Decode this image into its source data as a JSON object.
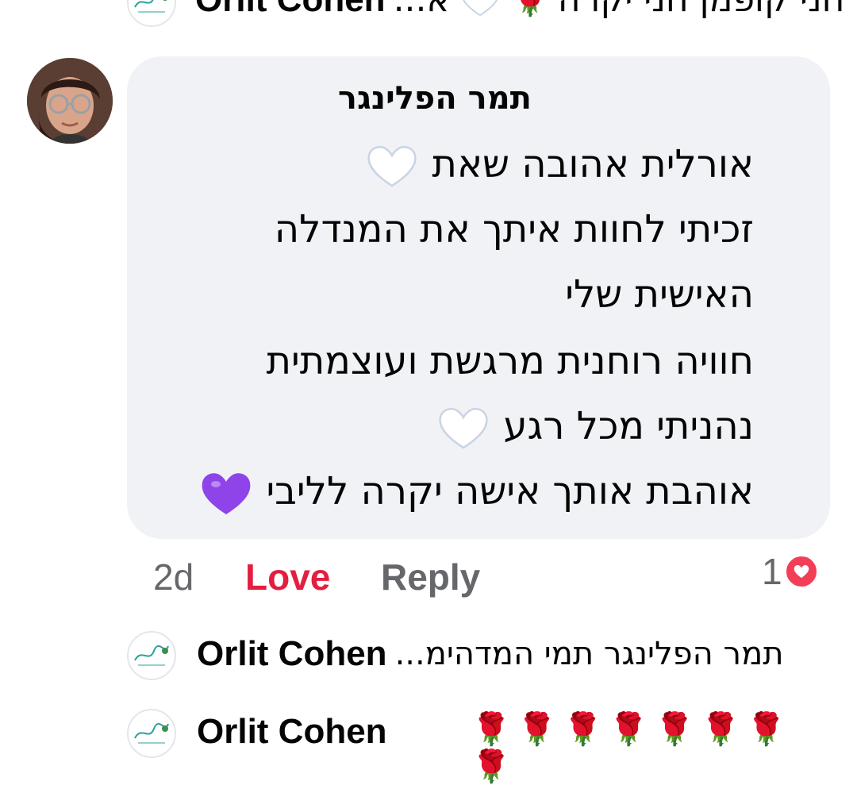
{
  "top_reply": {
    "name": "Orlit Cohen",
    "text_prefix": "א...",
    "text_main": "חני קופמן חני יקרה"
  },
  "comment": {
    "author": "תמר הפלינגר",
    "lines": [
      "אורלית אהובה שאת",
      "זכיתי לחוות איתך את המנדלה",
      "האישית שלי",
      "חוויה רוחנית מרגשת ועוצמתית",
      "נהניתי מכל רגע",
      "אוהבת אותך אישה יקרה לליבי"
    ],
    "time": "2d",
    "love_label": "Love",
    "reply_label": "Reply",
    "reaction_count": "1",
    "reaction_type": "love",
    "colors": {
      "love": "#e41e3f",
      "bubble": "#f0f2f5",
      "muted": "#65676b"
    }
  },
  "reply_1": {
    "name": "Orlit Cohen",
    "text": "תמר הפלינגר תמי המדהימ..."
  },
  "reply_2": {
    "name": "Orlit Cohen",
    "roses": "🌹🌹🌹🌹🌹🌹🌹🌹"
  }
}
